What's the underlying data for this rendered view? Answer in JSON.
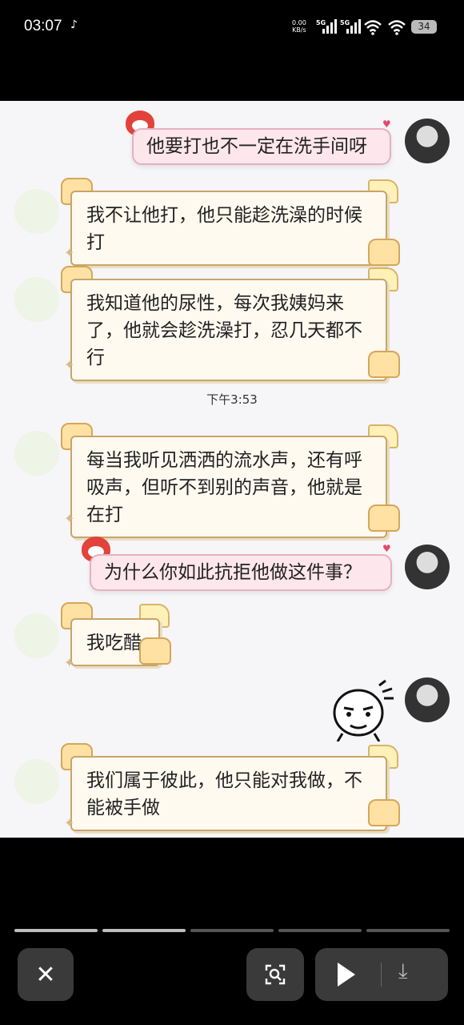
{
  "status": {
    "time": "03:07",
    "app_icon": "tiktok-icon",
    "net_speed_value": "0.00",
    "net_speed_unit": "KB/s",
    "sig1": "5G",
    "sig2": "5G",
    "battery": "34"
  },
  "chat": {
    "messages": [
      {
        "side": "right",
        "text": "他要打也不一定在洗手间呀"
      },
      {
        "side": "left",
        "text": "我不让他打，他只能趁洗澡的时候打"
      },
      {
        "side": "left",
        "text": "我知道他的尿性，每次我姨妈来了，他就会趁洗澡打，忍几天都不行"
      },
      {
        "side": "left",
        "text": "每当我听见洒洒的流水声，还有呼吸声，但听不到别的声音，他就是在打"
      },
      {
        "side": "right",
        "text": "为什么你如此抗拒他做这件事？"
      },
      {
        "side": "left",
        "text": "我吃醋"
      },
      {
        "side": "left",
        "text": "我们属于彼此，他只能对我做，不能被手做"
      }
    ],
    "timestamp": "下午3:53"
  },
  "controls": {
    "close_icon": "close-icon",
    "scan_icon": "scan-icon",
    "play_icon": "play-icon",
    "download_icon": "download-icon"
  },
  "colors": {
    "left_bubble": "#fffaf0",
    "right_bubble": "#fde6ec",
    "screen_bg": "#000000"
  }
}
